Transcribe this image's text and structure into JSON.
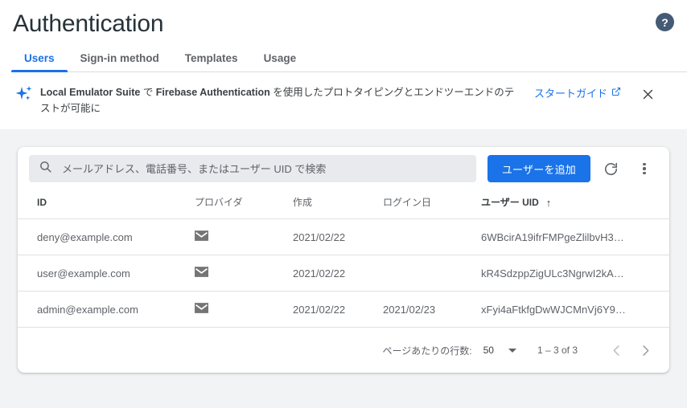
{
  "header": {
    "title": "Authentication",
    "help_icon": "help-circle-icon",
    "help_glyph": "?"
  },
  "tabs": [
    {
      "label": "Users",
      "active": true
    },
    {
      "label": "Sign-in method",
      "active": false
    },
    {
      "label": "Templates",
      "active": false
    },
    {
      "label": "Usage",
      "active": false
    }
  ],
  "banner": {
    "icon": "sparkles-icon",
    "text_part1": "Local Emulator Suite",
    "text_part2": " で ",
    "text_part3": "Firebase Authentication",
    "text_part4": " を使用したプロトタイピングとエンドツーエンドのテストが可能に",
    "cta_label": "スタートガイド",
    "cta_icon": "external-link-icon",
    "close_icon": "close-icon",
    "accent_color": "#1a73e8"
  },
  "toolbar": {
    "search_placeholder": "メールアドレス、電話番号、またはユーザー UID で検索",
    "search_value": "",
    "search_icon": "search-icon",
    "add_user_label": "ユーザーを追加",
    "refresh_icon": "refresh-icon",
    "more_icon": "more-vertical-icon",
    "primary_color": "#1a73e8"
  },
  "table": {
    "columns": [
      {
        "key": "id",
        "label": "ID",
        "bold": true
      },
      {
        "key": "provider",
        "label": "プロバイダ",
        "bold": false
      },
      {
        "key": "created",
        "label": "作成",
        "bold": false
      },
      {
        "key": "signed_in",
        "label": "ログイン日",
        "bold": false
      },
      {
        "key": "uid",
        "label": "ユーザー UID",
        "bold": true,
        "sort": "asc",
        "sort_glyph": "↑"
      }
    ],
    "rows": [
      {
        "id": "deny@example.com",
        "provider_icon": "email-envelope-icon",
        "created": "2021/02/22",
        "signed_in": "",
        "uid": "6WBcirA19ifrFMPgeZlilbvH3…"
      },
      {
        "id": "user@example.com",
        "provider_icon": "email-envelope-icon",
        "created": "2021/02/22",
        "signed_in": "",
        "uid": "kR4SdzppZigULc3NgrwI2kA…"
      },
      {
        "id": "admin@example.com",
        "provider_icon": "email-envelope-icon",
        "created": "2021/02/22",
        "signed_in": "2021/02/23",
        "uid": "xFyi4aFtkfgDwWJCMnVj6Y9…"
      }
    ]
  },
  "pagination": {
    "rows_per_page_label": "ページあたりの行数:",
    "rows_per_page_value": "50",
    "range_label": "1 – 3 of 3",
    "prev_icon": "chevron-left-icon",
    "next_icon": "chevron-right-icon"
  }
}
